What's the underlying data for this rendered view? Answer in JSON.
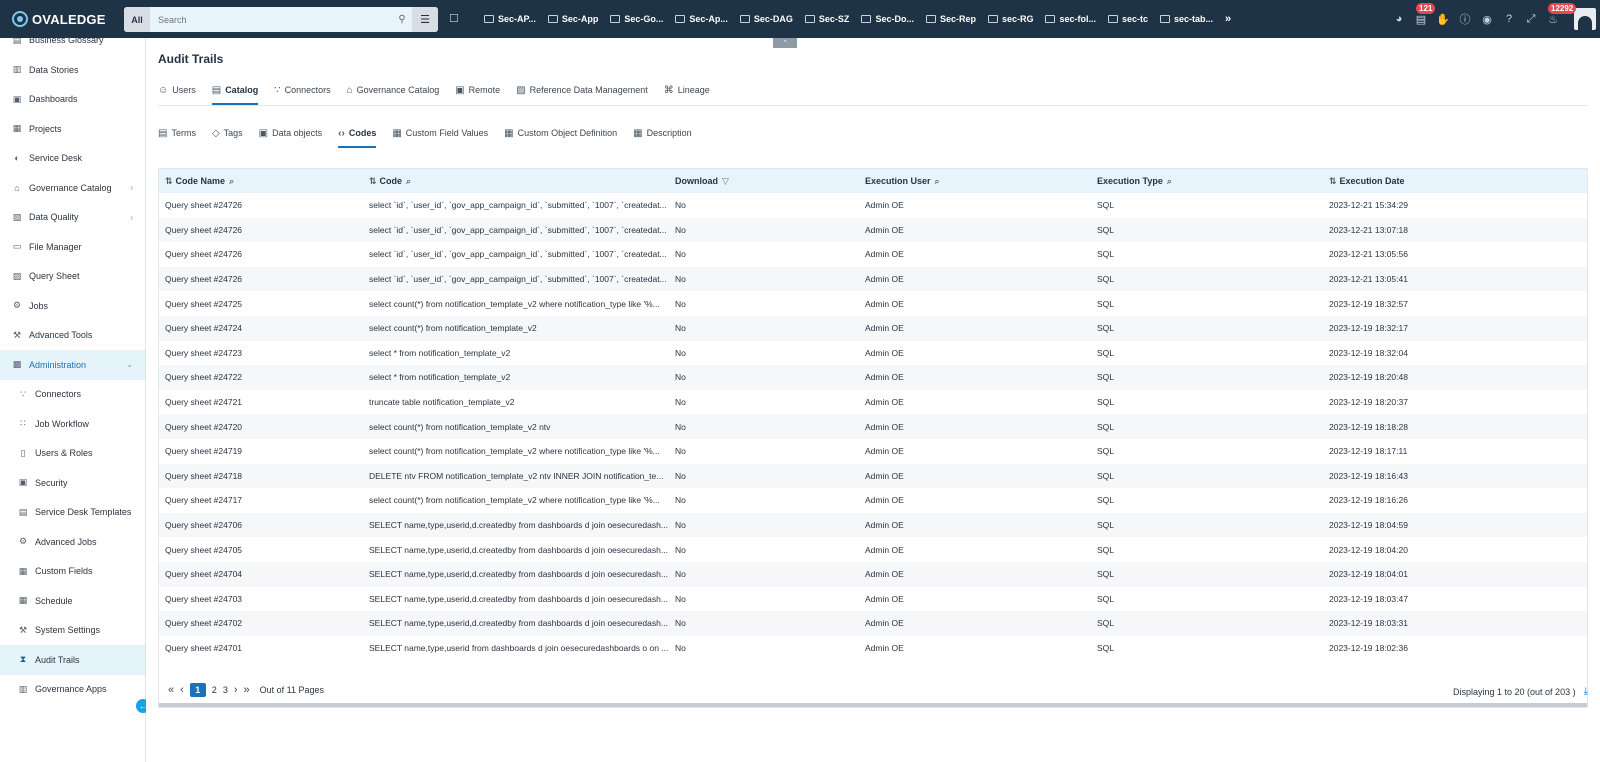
{
  "app": {
    "logo_text": "OVALEDGE"
  },
  "search": {
    "scope": "All",
    "placeholder": "Search"
  },
  "quick_tabs": [
    "Sec-AP...",
    "Sec-App",
    "Sec-Go...",
    "Sec-Ap...",
    "Sec-DAG",
    "Sec-SZ",
    "Sec-Do...",
    "Sec-Rep",
    "sec-RG",
    "sec-fol...",
    "sec-tc",
    "sec-tab..."
  ],
  "top_badges": {
    "tasks": "121",
    "notifications": "12292"
  },
  "sidebar": {
    "items": [
      {
        "label": "Business Glossary",
        "icon": "glossary-icon"
      },
      {
        "label": "Data Stories",
        "icon": "book-icon"
      },
      {
        "label": "Dashboards",
        "icon": "dashboard-icon"
      },
      {
        "label": "Projects",
        "icon": "projects-icon"
      },
      {
        "label": "Service Desk",
        "icon": "service-desk-icon"
      },
      {
        "label": "Governance Catalog",
        "icon": "bank-icon"
      },
      {
        "label": "Data Quality",
        "icon": "data-quality-icon"
      },
      {
        "label": "File Manager",
        "icon": "file-icon"
      },
      {
        "label": "Query Sheet",
        "icon": "query-icon"
      },
      {
        "label": "Jobs",
        "icon": "jobs-icon"
      },
      {
        "label": "Advanced Tools",
        "icon": "tools-icon"
      },
      {
        "label": "Administration",
        "icon": "admin-icon"
      },
      {
        "label": "Connectors",
        "icon": "connectors-icon"
      },
      {
        "label": "Job Workflow",
        "icon": "workflow-icon"
      },
      {
        "label": "Users & Roles",
        "icon": "users-icon"
      },
      {
        "label": "Security",
        "icon": "lock-icon"
      },
      {
        "label": "Service Desk Templates",
        "icon": "template-icon"
      },
      {
        "label": "Advanced Jobs",
        "icon": "advanced-jobs-icon"
      },
      {
        "label": "Custom Fields",
        "icon": "custom-fields-icon"
      },
      {
        "label": "Schedule",
        "icon": "calendar-icon"
      },
      {
        "label": "System Settings",
        "icon": "wrench-icon"
      },
      {
        "label": "Audit Trails",
        "icon": "hourglass-icon"
      },
      {
        "label": "Governance Apps",
        "icon": "apps-icon"
      }
    ]
  },
  "page": {
    "title": "Audit Trails"
  },
  "tabs_primary": [
    "Users",
    "Catalog",
    "Connectors",
    "Governance Catalog",
    "Remote",
    "Reference Data Management",
    "Lineage"
  ],
  "tabs_secondary": [
    "Terms",
    "Tags",
    "Data objects",
    "Codes",
    "Custom Field Values",
    "Custom Object Definition",
    "Description"
  ],
  "table": {
    "columns": [
      "Code Name",
      "Code",
      "Download",
      "Execution User",
      "Execution Type",
      "Execution Date"
    ],
    "rows": [
      [
        "Query sheet #24726",
        "select `id`, `user_id`, `gov_app_campaign_id`, `submitted`, `1007`, `createdat...",
        "No",
        "Admin OE",
        "SQL",
        "2023-12-21 15:34:29"
      ],
      [
        "Query sheet #24726",
        "select `id`, `user_id`, `gov_app_campaign_id`, `submitted`, `1007`, `createdat...",
        "No",
        "Admin OE",
        "SQL",
        "2023-12-21 13:07:18"
      ],
      [
        "Query sheet #24726",
        "select `id`, `user_id`, `gov_app_campaign_id`, `submitted`, `1007`, `createdat...",
        "No",
        "Admin OE",
        "SQL",
        "2023-12-21 13:05:56"
      ],
      [
        "Query sheet #24726",
        "select `id`, `user_id`, `gov_app_campaign_id`, `submitted`, `1007`, `createdat...",
        "No",
        "Admin OE",
        "SQL",
        "2023-12-21 13:05:41"
      ],
      [
        "Query sheet #24725",
        "select count(*) from notification_template_v2 where notification_type like '%...",
        "No",
        "Admin OE",
        "SQL",
        "2023-12-19 18:32:57"
      ],
      [
        "Query sheet #24724",
        "select count(*) from notification_template_v2",
        "No",
        "Admin OE",
        "SQL",
        "2023-12-19 18:32:17"
      ],
      [
        "Query sheet #24723",
        "select * from notification_template_v2",
        "No",
        "Admin OE",
        "SQL",
        "2023-12-19 18:32:04"
      ],
      [
        "Query sheet #24722",
        "select * from notification_template_v2",
        "No",
        "Admin OE",
        "SQL",
        "2023-12-19 18:20:48"
      ],
      [
        "Query sheet #24721",
        "truncate table notification_template_v2",
        "No",
        "Admin OE",
        "SQL",
        "2023-12-19 18:20:37"
      ],
      [
        "Query sheet #24720",
        "select count(*) from notification_template_v2 ntv",
        "No",
        "Admin OE",
        "SQL",
        "2023-12-19 18:18:28"
      ],
      [
        "Query sheet #24719",
        "select count(*) from notification_template_v2 where notification_type like '%...",
        "No",
        "Admin OE",
        "SQL",
        "2023-12-19 18:17:11"
      ],
      [
        "Query sheet #24718",
        "DELETE ntv FROM notification_template_v2 ntv INNER JOIN notification_te...",
        "No",
        "Admin OE",
        "SQL",
        "2023-12-19 18:16:43"
      ],
      [
        "Query sheet #24717",
        "select count(*) from notification_template_v2 where notification_type like '%...",
        "No",
        "Admin OE",
        "SQL",
        "2023-12-19 18:16:26"
      ],
      [
        "Query sheet #24706",
        "SELECT name,type,userid,d.createdby from dashboards d join oesecuredash...",
        "No",
        "Admin OE",
        "SQL",
        "2023-12-19 18:04:59"
      ],
      [
        "Query sheet #24705",
        "SELECT name,type,userid,d.createdby from dashboards d join oesecuredash...",
        "No",
        "Admin OE",
        "SQL",
        "2023-12-19 18:04:20"
      ],
      [
        "Query sheet #24704",
        "SELECT name,type,userid,d.createdby from dashboards d join oesecuredash...",
        "No",
        "Admin OE",
        "SQL",
        "2023-12-19 18:04:01"
      ],
      [
        "Query sheet #24703",
        "SELECT name,type,userid,d.createdby from dashboards d join oesecuredash...",
        "No",
        "Admin OE",
        "SQL",
        "2023-12-19 18:03:47"
      ],
      [
        "Query sheet #24702",
        "SELECT name,type,userid,d.createdby from dashboards d join oesecuredash...",
        "No",
        "Admin OE",
        "SQL",
        "2023-12-19 18:03:31"
      ],
      [
        "Query sheet #24701",
        "SELECT name,type,userid from dashboards d join oesecuredashboards o on ...",
        "No",
        "Admin OE",
        "SQL",
        "2023-12-19 18:02:36"
      ]
    ]
  },
  "pagination": {
    "pages": [
      "1",
      "2",
      "3"
    ],
    "current": "1",
    "summary": "Out of 11 Pages",
    "display": "Displaying 1 to 20  (out of 203 )"
  },
  "colors": {
    "topbar": "#1f3346",
    "accent": "#1a73b8",
    "header_bg": "#e8f4fc"
  }
}
